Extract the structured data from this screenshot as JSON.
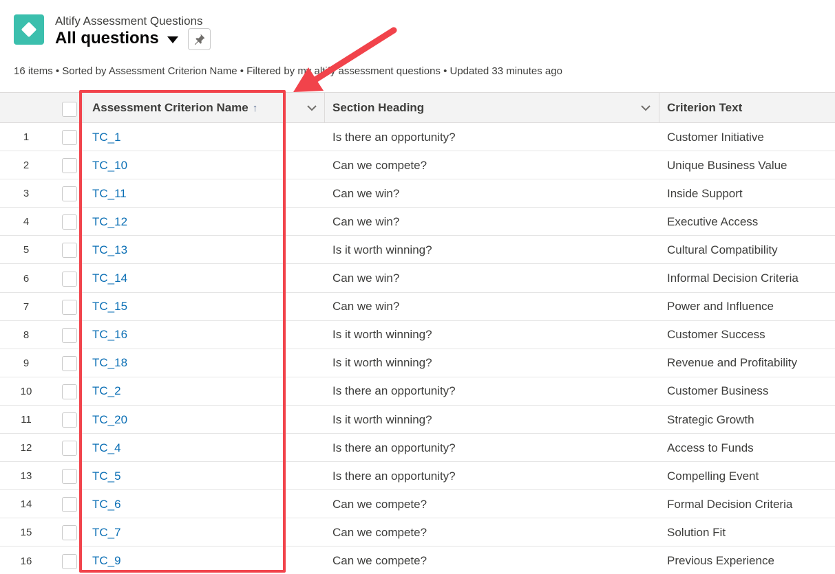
{
  "header": {
    "object_label": "Altify Assessment Questions",
    "list_view_title": "All questions",
    "list_info": "16 items • Sorted by Assessment Criterion Name • Filtered by my altify assessment questions • Updated 33 minutes ago"
  },
  "table": {
    "columns": [
      {
        "label": "Assessment Criterion Name",
        "sort_indicator": "↑"
      },
      {
        "label": "Section Heading"
      },
      {
        "label": "Criterion Text"
      }
    ],
    "rows": [
      {
        "num": "1",
        "name": "TC_1",
        "section": "Is there an opportunity?",
        "criterion": "Customer Initiative"
      },
      {
        "num": "2",
        "name": "TC_10",
        "section": "Can we compete?",
        "criterion": "Unique Business Value"
      },
      {
        "num": "3",
        "name": "TC_11",
        "section": "Can we win?",
        "criterion": "Inside Support"
      },
      {
        "num": "4",
        "name": "TC_12",
        "section": "Can we win?",
        "criterion": "Executive Access"
      },
      {
        "num": "5",
        "name": "TC_13",
        "section": "Is it worth winning?",
        "criterion": "Cultural Compatibility"
      },
      {
        "num": "6",
        "name": "TC_14",
        "section": "Can we win?",
        "criterion": "Informal Decision Criteria"
      },
      {
        "num": "7",
        "name": "TC_15",
        "section": "Can we win?",
        "criterion": "Power and Influence"
      },
      {
        "num": "8",
        "name": "TC_16",
        "section": "Is it worth winning?",
        "criterion": "Customer Success"
      },
      {
        "num": "9",
        "name": "TC_18",
        "section": "Is it worth winning?",
        "criterion": "Revenue and Profitability"
      },
      {
        "num": "10",
        "name": "TC_2",
        "section": "Is there an opportunity?",
        "criterion": "Customer Business"
      },
      {
        "num": "11",
        "name": "TC_20",
        "section": "Is it worth winning?",
        "criterion": "Strategic Growth"
      },
      {
        "num": "12",
        "name": "TC_4",
        "section": "Is there an opportunity?",
        "criterion": "Access to Funds"
      },
      {
        "num": "13",
        "name": "TC_5",
        "section": "Is there an opportunity?",
        "criterion": "Compelling Event"
      },
      {
        "num": "14",
        "name": "TC_6",
        "section": "Can we compete?",
        "criterion": "Formal Decision Criteria"
      },
      {
        "num": "15",
        "name": "TC_7",
        "section": "Can we compete?",
        "criterion": "Solution Fit"
      },
      {
        "num": "16",
        "name": "TC_9",
        "section": "Can we compete?",
        "criterion": "Previous Experience"
      }
    ]
  },
  "colors": {
    "app_icon": "#3bbfad",
    "link": "#0b6fb5",
    "annotation": "#f1434b"
  }
}
